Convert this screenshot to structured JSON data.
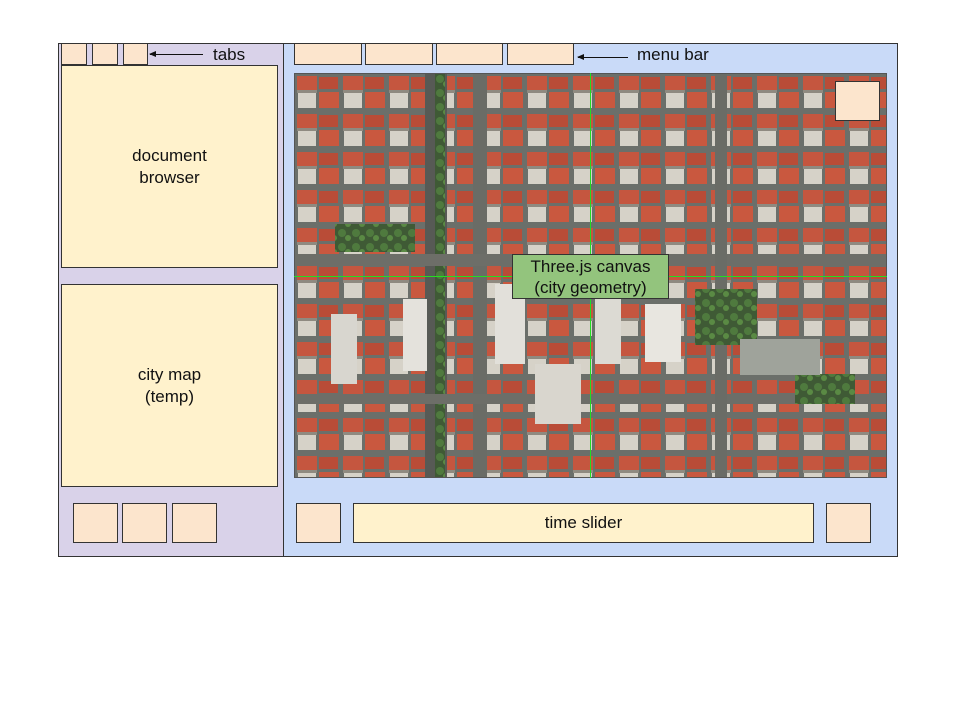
{
  "labels": {
    "tabs": "tabs",
    "menu_bar": "menu bar"
  },
  "left": {
    "document_browser": "document\nbrowser",
    "city_map": "city map\n(temp)"
  },
  "center": {
    "canvas_label": "Three.js canvas\n(city geometry)",
    "time_slider": "time slider"
  },
  "colors": {
    "left_panel": "#d9d2e9",
    "right_panel": "#c9daf8",
    "box": "#fff2cc",
    "button": "#fce5cd",
    "canvas_label": "#93c47d",
    "crosshair": "#22dd22"
  },
  "image": {
    "subject": "aerial city view with red-tiled roofs"
  }
}
